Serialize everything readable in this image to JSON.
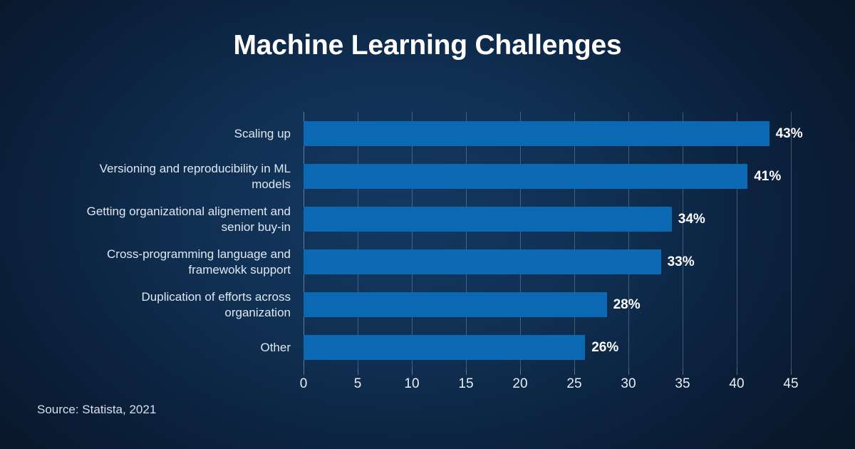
{
  "title": "Machine Learning Challenges",
  "source_note": "Source: Statista, 2021",
  "colors": {
    "bar": "#0b68b3",
    "background_dark": "#091729",
    "background_mid": "#143862",
    "text": "#ffffff",
    "label_text": "#dfe7f1",
    "gridline": "#b0c8e1"
  },
  "chart_data": {
    "type": "bar",
    "orientation": "horizontal",
    "title": "Machine Learning Challenges",
    "subtitle": "",
    "xlabel": "",
    "ylabel": "",
    "xlim": [
      0,
      45
    ],
    "xticks": [
      0,
      5,
      10,
      15,
      20,
      25,
      30,
      35,
      40,
      45
    ],
    "xtick_labels": [
      "0",
      "5",
      "10",
      "15",
      "20",
      "25",
      "30",
      "35",
      "40",
      "45"
    ],
    "grid": true,
    "legend": false,
    "value_label_suffix": "%",
    "categories": [
      "Scaling up",
      "Versioning and reproducibility in ML models",
      "Getting organizational alignement and senior buy-in",
      "Cross-programming language and framewokk support",
      "Duplication of efforts across organization",
      "Other"
    ],
    "category_lines": [
      [
        "Scaling up"
      ],
      [
        "Versioning and reproducibility in ML",
        "models"
      ],
      [
        "Getting organizational alignement and",
        "senior buy-in"
      ],
      [
        "Cross-programming language and",
        "framewokk support"
      ],
      [
        "Duplication of efforts across",
        "organization"
      ],
      [
        "Other"
      ]
    ],
    "values": [
      43,
      41,
      34,
      33,
      28,
      26
    ],
    "value_labels": [
      "43%",
      "41%",
      "34%",
      "33%",
      "28%",
      "26%"
    ],
    "source": "Source: Statista, 2021"
  }
}
